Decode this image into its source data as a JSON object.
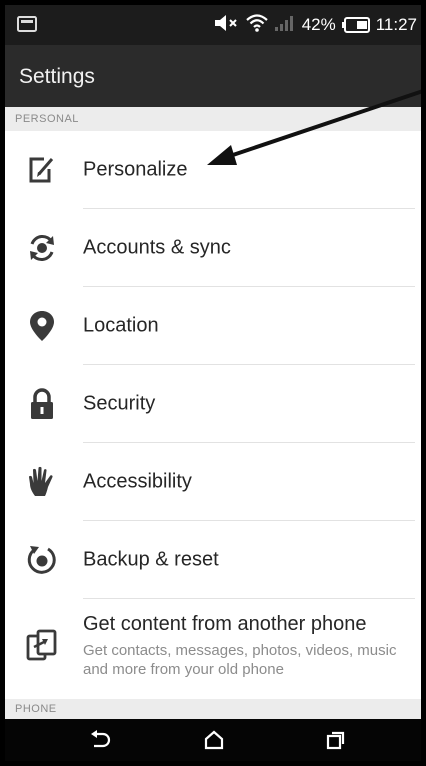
{
  "status_bar": {
    "battery_percent": "42%",
    "time": "11:27",
    "icons": [
      "notification-icon",
      "volume-muted-icon",
      "wifi-icon",
      "signal-icon",
      "battery-icon"
    ]
  },
  "app_bar": {
    "title": "Settings"
  },
  "sections": {
    "personal": "PERSONAL",
    "phone": "PHONE"
  },
  "items": [
    {
      "label": "Personalize",
      "icon": "personalize-icon"
    },
    {
      "label": "Accounts & sync",
      "icon": "sync-icon"
    },
    {
      "label": "Location",
      "icon": "location-pin-icon"
    },
    {
      "label": "Security",
      "icon": "lock-icon"
    },
    {
      "label": "Accessibility",
      "icon": "hand-icon"
    },
    {
      "label": "Backup & reset",
      "icon": "backup-icon"
    },
    {
      "label": "Get content from another phone",
      "subtitle": "Get contacts, messages, photos, videos, music and more from your old phone",
      "icon": "transfer-icon"
    }
  ],
  "nav_bar": {
    "icons": [
      "back-icon",
      "home-icon",
      "recent-apps-icon"
    ]
  },
  "colors": {
    "status_bar_bg": "#1c1c1c",
    "app_bar_bg": "#2b2b2b",
    "nav_bar_bg": "#050505",
    "section_header_bg": "#ececec",
    "icon_color": "#3a3a3a"
  }
}
